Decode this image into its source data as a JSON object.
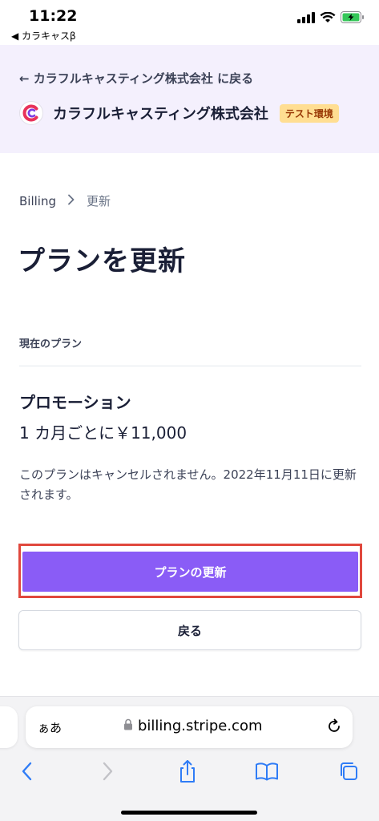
{
  "status_bar": {
    "time": "11:22",
    "back_app": "◀ カラキャスβ"
  },
  "header": {
    "back_link": "← カラフルキャスティング株式会社 に戻る",
    "company_name": "カラフルキャスティング株式会社",
    "badge": "テスト環境"
  },
  "breadcrumb": {
    "billing": "Billing",
    "separator": ">",
    "current": "更新"
  },
  "page_title": "プランを更新",
  "current_plan": {
    "section_label": "現在のプラン",
    "plan_name": "プロモーション",
    "price": "1 カ月ごとに￥11,000",
    "note": "このプランはキャンセルされません。2022年11月11日に更新されます。"
  },
  "buttons": {
    "update_plan": "プランの更新",
    "back": "戻る"
  },
  "browser": {
    "aa_label": "ぁあ",
    "url": "billing.stripe.com"
  },
  "colors": {
    "accent": "#8a5cf6",
    "header_bg": "#f4f0fd",
    "badge_bg": "#ffde92",
    "highlight": "#e0483d"
  },
  "icons": [
    "signal-icon",
    "wifi-icon",
    "battery-icon",
    "logo-icon",
    "lock-icon",
    "reload-icon",
    "back-icon",
    "forward-icon",
    "share-icon",
    "bookmarks-icon",
    "tabs-icon"
  ]
}
